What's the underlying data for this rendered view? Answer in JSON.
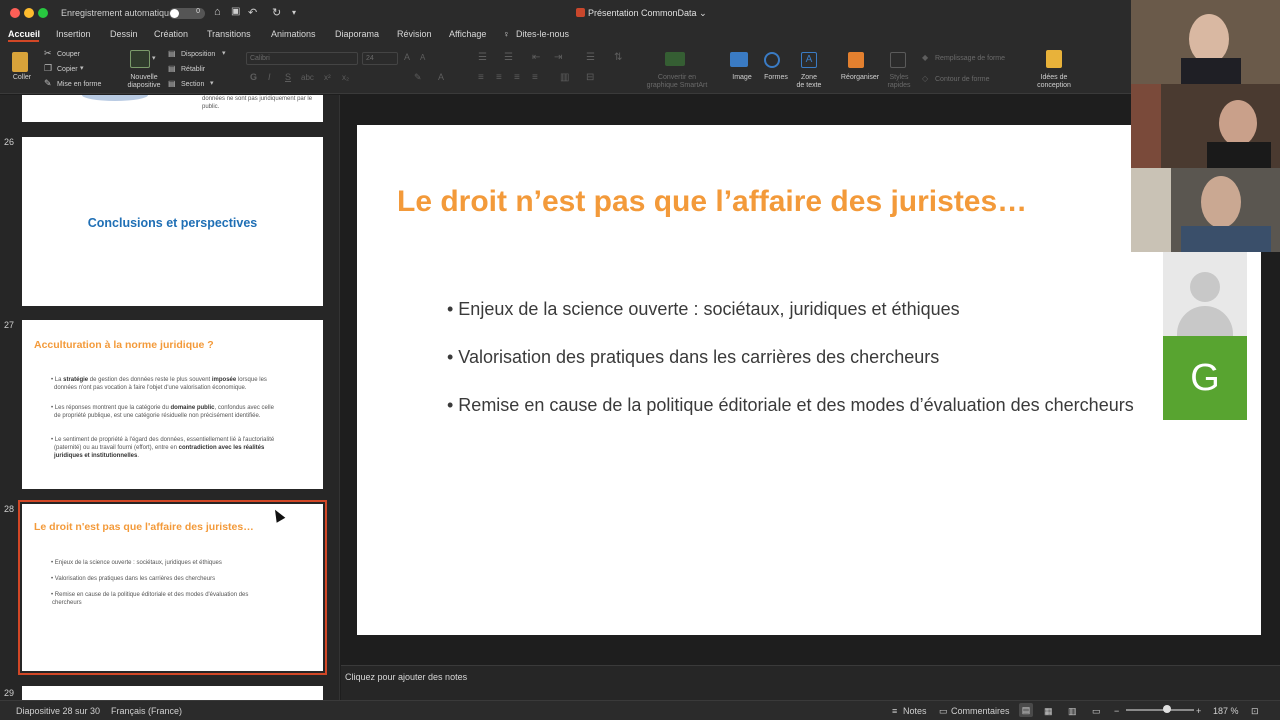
{
  "titlebar": {
    "autosave_label": "Enregistrement automatique",
    "toggle_label": "0",
    "document_title": "Présentation CommonData",
    "traffic_colors": [
      "#fe5f57",
      "#febc2e",
      "#28c840"
    ]
  },
  "tabs": [
    "Accueil",
    "Insertion",
    "Dessin",
    "Création",
    "Transitions",
    "Animations",
    "Diaporama",
    "Révision",
    "Affichage",
    "Dites-le-nous"
  ],
  "ribbon": {
    "coller": "Coller",
    "couper": "Couper",
    "copier": "Copier",
    "mise_en_forme": "Mise en forme",
    "nouvelle_1": "Nouvelle",
    "nouvelle_2": "diapositive",
    "disposition": "Disposition",
    "retablir": "Rétablir",
    "section": "Section",
    "font_name": "Calibri",
    "font_size": "24",
    "convertir_1": "Convertir en",
    "convertir_2": "graphique SmartArt",
    "image": "Image",
    "formes": "Formes",
    "zone_1": "Zone",
    "zone_2": "de texte",
    "reorganiser": "Réorganiser",
    "styles_1": "Styles",
    "styles_2": "rapides",
    "remplissage": "Remplissage de forme",
    "contour": "Contour de forme",
    "idees_1": "Idées de",
    "idees_2": "conception",
    "accent": "#d24726"
  },
  "thumbnails": {
    "t25_tail_1": "données ne sont pas juridiquement par le",
    "t25_tail_2": "public.",
    "t26_num": "26",
    "t26_title": "Conclusions et perspectives",
    "t27_num": "27",
    "t27_title": "Acculturation à la norme juridique ?",
    "t27_b1_a": "• La ",
    "t27_b1_b": "stratégie",
    "t27_b1_c": " de gestion des données reste le plus souvent ",
    "t27_b1_d": "imposée",
    "t27_b1_e": " lorsque les",
    "t27_b1_f": "données n'ont pas vocation à faire l'objet d'une valorisation économique.",
    "t27_b2_a": "• Les réponses montrent que la catégorie du ",
    "t27_b2_b": "domaine public",
    "t27_b2_c": ", confondus avec celle",
    "t27_b2_d": "de propriété publique, est une catégorie résiduelle non précisément identifiée.",
    "t27_b3_a": "• Le sentiment de propriété à l'égard des données, essentiellement lié à l'auctorialité",
    "t27_b3_b": "(paternité) ou au travail fourni (effort), entre en ",
    "t27_b3_c": "contradiction avec les réalités",
    "t27_b3_d": "juridiques et institutionnelles",
    "t27_b3_e": ".",
    "t28_num": "28",
    "t28_title": "Le droit n'est pas que l'affaire des juristes…",
    "t28_b1": "• Enjeux de la science ouverte : sociétaux, juridiques et éthiques",
    "t28_b2": "• Valorisation des pratiques dans les carrières des chercheurs",
    "t28_b3_1": "• Remise en cause de la politique éditoriale et des modes d'évaluation des",
    "t28_b3_2": "chercheurs",
    "t29_num": "29"
  },
  "slide": {
    "title": "Le droit n’est pas que l’affaire des juristes…",
    "bullet_1": "• Enjeux de la science ouverte : sociétaux, juridiques et éthiques",
    "bullet_2": "• Valorisation des pratiques dans les carrières des chercheurs",
    "bullet_3": "• Remise en cause de la politique éditoriale et des modes d’évaluation des chercheurs",
    "title_color": "#f39a3a"
  },
  "notes": {
    "placeholder": "Cliquez pour ajouter des notes"
  },
  "statusbar": {
    "slide_counter": "Diapositive 28 sur 30",
    "language": "Français (France)",
    "notes": "Notes",
    "comments": "Commentaires",
    "zoom": "187 %",
    "zoom_minus": "−",
    "zoom_plus": "+"
  },
  "video": {
    "participant_initial": "G",
    "tile_color": "#58a430"
  }
}
